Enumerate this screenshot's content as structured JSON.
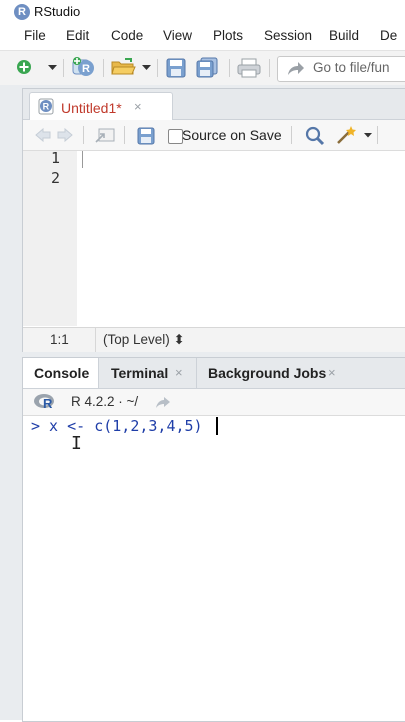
{
  "window": {
    "title": "RStudio",
    "logo_letter": "R"
  },
  "menu": [
    "File",
    "Edit",
    "Code",
    "View",
    "Plots",
    "Session",
    "Build",
    "De"
  ],
  "toolbar": {
    "goto_placeholder": "Go to file/fun"
  },
  "source": {
    "tab_label": "Untitled1*",
    "tab_close": "×",
    "source_on_save_label": "Source on Save",
    "source_on_save_checked": false,
    "line_numbers": [
      "1",
      "2"
    ],
    "cursor_position": "1:1",
    "scope": "(Top Level) ⬍"
  },
  "console": {
    "tabs": [
      {
        "label": "Console",
        "closable": false,
        "active": true
      },
      {
        "label": "Terminal",
        "closable": true,
        "active": false
      },
      {
        "label": "Background Jobs",
        "closable": true,
        "active": false
      }
    ],
    "close_glyph": "×",
    "r_version": "R 4.2.2 · ~/",
    "input_line": "> x <- c(1,2,3,4,5)"
  },
  "colors": {
    "accent_blue": "#1f3ea8",
    "tab_modified_red": "#c0392b",
    "pane_border": "#c8cdd3"
  }
}
